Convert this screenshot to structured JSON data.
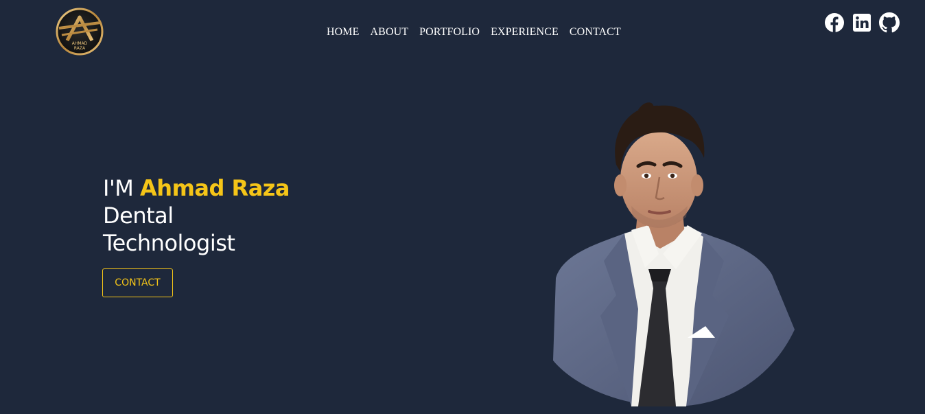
{
  "logo": {
    "text_line1": "AHMAD",
    "text_line2": "RAZA",
    "icon": "monogram-logo"
  },
  "nav": {
    "items": [
      {
        "label": "HOME"
      },
      {
        "label": "ABOUT"
      },
      {
        "label": "PORTFOLIO"
      },
      {
        "label": "EXPERIENCE"
      },
      {
        "label": "CONTACT"
      }
    ]
  },
  "social": {
    "icons": [
      "facebook-icon",
      "linkedin-icon",
      "github-icon"
    ]
  },
  "hero": {
    "intro": "I'M ",
    "name": "Ahmad Raza",
    "title_line1": "Dental",
    "title_line2": "Technologist",
    "button_label": "CONTACT"
  },
  "colors": {
    "background": "#1e283b",
    "accent": "#f5c518",
    "text": "#ffffff"
  }
}
